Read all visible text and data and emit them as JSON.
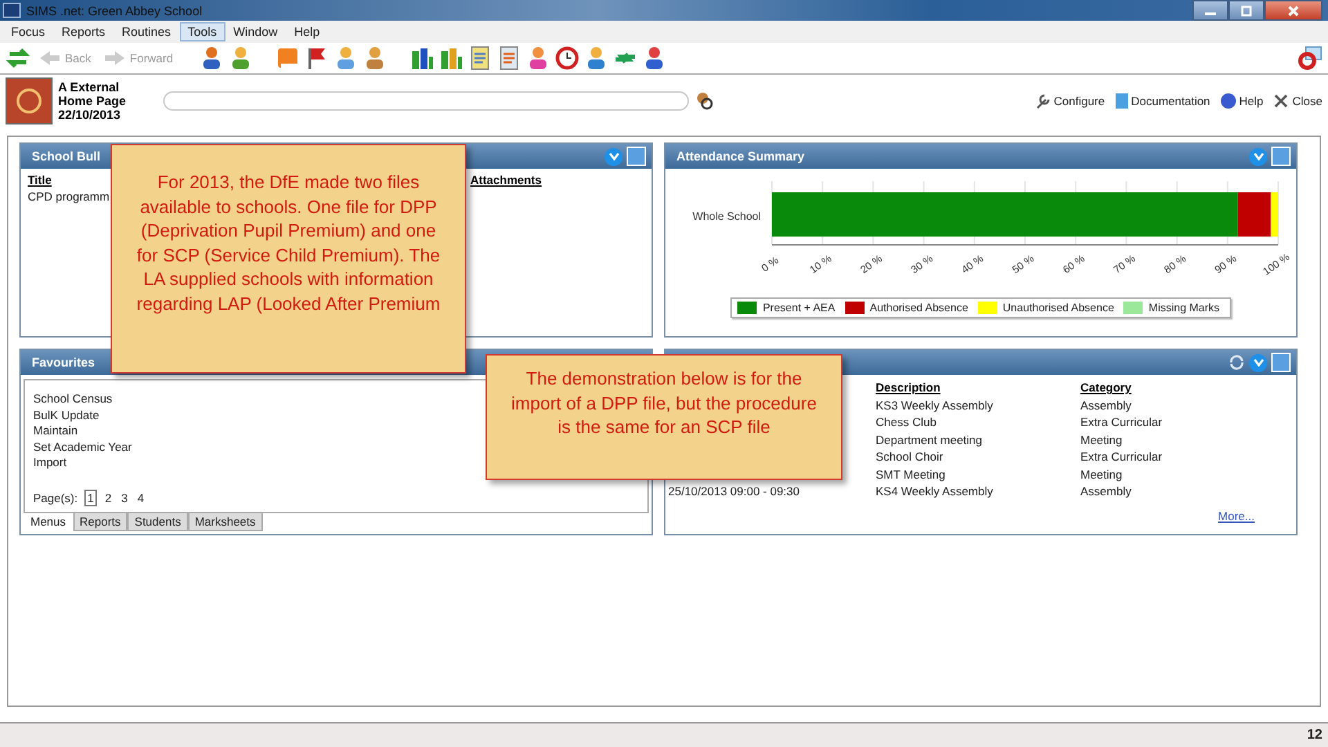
{
  "window": {
    "title": "SIMS .net: Green Abbey School"
  },
  "menu": [
    {
      "label": "Focus",
      "selected": false
    },
    {
      "label": "Reports",
      "selected": false
    },
    {
      "label": "Routines",
      "selected": false
    },
    {
      "label": "Tools",
      "selected": true
    },
    {
      "label": "Window",
      "selected": false
    },
    {
      "label": "Help",
      "selected": false
    }
  ],
  "toolbar": {
    "back": "Back",
    "forward": "Forward"
  },
  "header": {
    "user": "A External",
    "page": "Home Page",
    "date": "22/10/2013",
    "links": [
      "Configure",
      "Documentation",
      "Help",
      "Close"
    ]
  },
  "bulletins": {
    "title": "School Bull",
    "columns": [
      "Title",
      "Attachments"
    ],
    "rows": [
      "CPD programm"
    ]
  },
  "attendance": {
    "title": "Attendance Summary",
    "chart_data": {
      "type": "bar",
      "orientation": "horizontal",
      "stacked": true,
      "categories": [
        "Whole School"
      ],
      "series": [
        {
          "name": "Present + AEA",
          "color": "#0a8a0a",
          "values": [
            92
          ]
        },
        {
          "name": "Authorised Absence",
          "color": "#c00000",
          "values": [
            6.5
          ]
        },
        {
          "name": "Unauthorised Absence",
          "color": "#ffff00",
          "values": [
            1.5
          ]
        },
        {
          "name": "Missing Marks",
          "color": "#9be89b",
          "values": [
            0
          ]
        }
      ],
      "grid": true,
      "legend": true,
      "xlim": [
        0,
        100
      ],
      "xticks": [
        {
          "value": 0,
          "label": "0 %"
        },
        {
          "value": 10,
          "label": "10 %"
        },
        {
          "value": 20,
          "label": "20 %"
        },
        {
          "value": 30,
          "label": "30 %"
        },
        {
          "value": 40,
          "label": "40 %"
        },
        {
          "value": 50,
          "label": "50 %"
        },
        {
          "value": 60,
          "label": "60 %"
        },
        {
          "value": 70,
          "label": "70 %"
        },
        {
          "value": 80,
          "label": "80 %"
        },
        {
          "value": 90,
          "label": "90 %"
        },
        {
          "value": 100,
          "label": "100 %"
        }
      ]
    }
  },
  "favourites": {
    "title": "Favourites",
    "items": [
      "School Census",
      "BulK Update",
      "Maintain",
      "Set Academic Year",
      "Import"
    ],
    "pages_label": "Page(s):",
    "pages": [
      {
        "label": "1",
        "selected": true
      },
      {
        "label": "2",
        "selected": false
      },
      {
        "label": "3",
        "selected": false
      },
      {
        "label": "4",
        "selected": false
      }
    ],
    "tabs": [
      {
        "label": "Menus",
        "selected": true
      },
      {
        "label": "Reports",
        "selected": false
      },
      {
        "label": "Students",
        "selected": false
      },
      {
        "label": "Marksheets",
        "selected": false
      }
    ]
  },
  "events": {
    "columns": [
      "Description",
      "Category"
    ],
    "rows": [
      {
        "description": "KS3 Weekly Assembly",
        "category": "Assembly"
      },
      {
        "description": "Chess Club",
        "category": "Extra Curricular"
      },
      {
        "description": "Department meeting",
        "category": "Meeting"
      },
      {
        "description": "School Choir",
        "category": "Extra Curricular"
      },
      {
        "description": "SMT Meeting",
        "category": "Meeting"
      },
      {
        "date": "25/10/2013 09:00 - 09:30",
        "description": "KS4 Weekly Assembly",
        "category": "Assembly"
      }
    ],
    "more": "More..."
  },
  "callouts": [
    "For 2013, the DfE made two files available to schools. One file for DPP (Deprivation Pupil Premium) and one for SCP (Service Child Premium).  The LA supplied schools with information regarding LAP (Looked After Premium",
    "The demonstration below is for the import of a DPP file, but the procedure is the same for an SCP file"
  ],
  "slide_number": "12"
}
